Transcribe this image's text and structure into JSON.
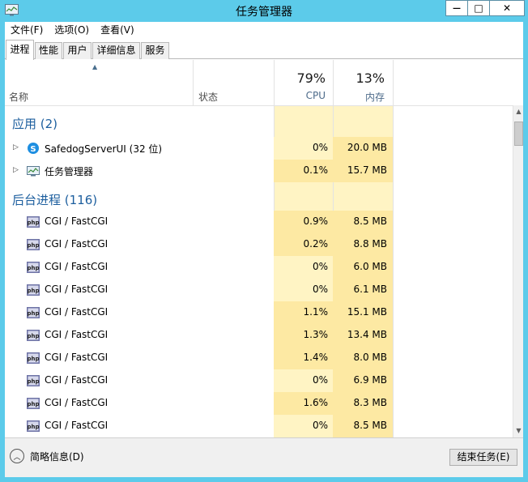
{
  "window": {
    "title": "任务管理器",
    "icon": "task-manager-icon",
    "controls": {
      "minimize": "—",
      "maximize": "□",
      "close": "✕"
    }
  },
  "menu": [
    {
      "label": "文件(F)"
    },
    {
      "label": "选项(O)"
    },
    {
      "label": "查看(V)"
    }
  ],
  "tabs": [
    {
      "label": "进程",
      "active": true
    },
    {
      "label": "性能",
      "active": false
    },
    {
      "label": "用户",
      "active": false
    },
    {
      "label": "详细信息",
      "active": false
    },
    {
      "label": "服务",
      "active": false
    }
  ],
  "columns": {
    "name": "名称",
    "status": "状态",
    "cpu": {
      "percent": "79%",
      "label": "CPU"
    },
    "memory": {
      "percent": "13%",
      "label": "内存"
    }
  },
  "groups": {
    "apps": {
      "title": "应用 (2)"
    },
    "background": {
      "title": "后台进程 (116)"
    }
  },
  "apps": [
    {
      "name": "SafedogServerUI (32 位)",
      "cpu": "0%",
      "memory": "20.0 MB",
      "icon": "safedog-icon"
    },
    {
      "name": "任务管理器",
      "cpu": "0.1%",
      "memory": "15.7 MB",
      "icon": "task-manager-icon"
    }
  ],
  "background": [
    {
      "name": "CGI / FastCGI",
      "cpu": "0.9%",
      "memory": "8.5 MB",
      "icon": "php-icon"
    },
    {
      "name": "CGI / FastCGI",
      "cpu": "0.2%",
      "memory": "8.8 MB",
      "icon": "php-icon"
    },
    {
      "name": "CGI / FastCGI",
      "cpu": "0%",
      "memory": "6.0 MB",
      "icon": "php-icon"
    },
    {
      "name": "CGI / FastCGI",
      "cpu": "0%",
      "memory": "6.1 MB",
      "icon": "php-icon"
    },
    {
      "name": "CGI / FastCGI",
      "cpu": "1.1%",
      "memory": "15.1 MB",
      "icon": "php-icon"
    },
    {
      "name": "CGI / FastCGI",
      "cpu": "1.3%",
      "memory": "13.4 MB",
      "icon": "php-icon"
    },
    {
      "name": "CGI / FastCGI",
      "cpu": "1.4%",
      "memory": "8.0 MB",
      "icon": "php-icon"
    },
    {
      "name": "CGI / FastCGI",
      "cpu": "0%",
      "memory": "6.9 MB",
      "icon": "php-icon"
    },
    {
      "name": "CGI / FastCGI",
      "cpu": "1.6%",
      "memory": "8.3 MB",
      "icon": "php-icon"
    },
    {
      "name": "CGI / FastCGI",
      "cpu": "0%",
      "memory": "8.5 MB",
      "icon": "php-icon"
    }
  ],
  "footer": {
    "fewer_details": "简略信息(D)",
    "end_task": "结束任务(E)"
  },
  "colors": {
    "frame": "#5ccbea",
    "group_title": "#1c5e9e",
    "heat_light": "#fff4c4",
    "heat_medium": "#fde9a3",
    "php_icon": "#6e73a6"
  }
}
